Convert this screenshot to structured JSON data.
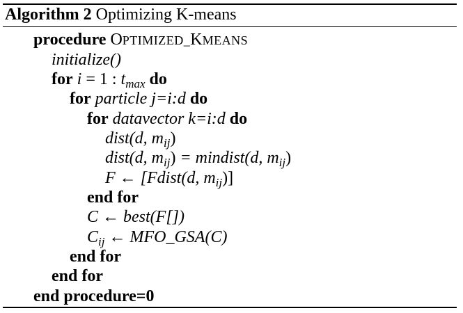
{
  "caption": {
    "label": "Algorithm 2",
    "title": "Optimizing K-means"
  },
  "lines": {
    "procedure_kw": "procedure",
    "procedure_name_first": "O",
    "procedure_name_rest": "PTIMIZED_",
    "procedure_name_k": "K",
    "procedure_name_tail": "MEANS",
    "initialize": "initialize()",
    "for_kw": "for",
    "do_kw": "do",
    "loop_i_var": "i",
    "loop_i_range": " = 1 : ",
    "loop_i_t": "t",
    "loop_i_sub": "max",
    "loop_j_text": "particle j=i:d",
    "loop_k_text": "datavector k=i:d",
    "dist_line": "dist(d, m",
    "dist_sub": "ij",
    "close_paren": ")",
    "dist_assign_right": " = mindist(d, m",
    "f_assign_left": "F ← [Fdist(d, m",
    "f_close": ")]",
    "end_for": "end for",
    "c_assign": "C ← best(F[])",
    "cij_c": "C",
    "cij_sub": "ij",
    "cij_assign": " ← MFO_GSA(C)",
    "end_procedure": "end procedure=0"
  }
}
